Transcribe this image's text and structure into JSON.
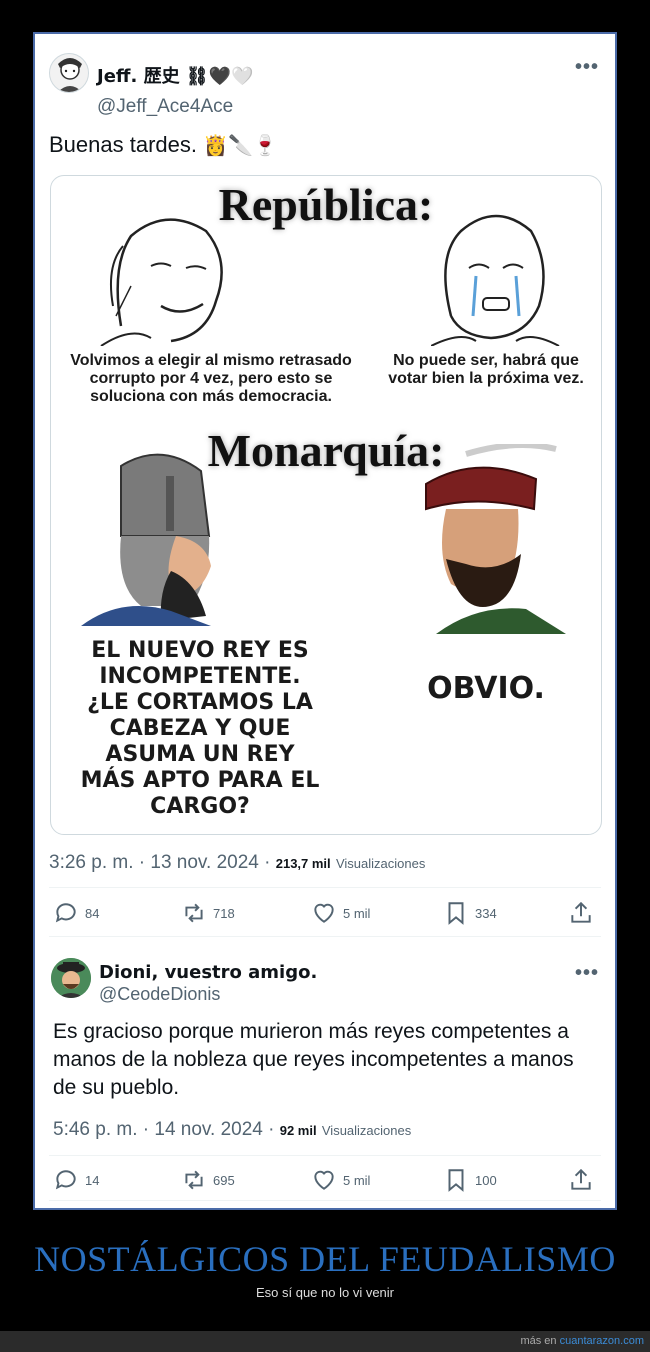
{
  "tweet": {
    "name": "Jeff. 歴史 ⛓🖤🤍",
    "handle": "@Jeff_Ace4Ace",
    "text": "Buenas tardes.",
    "emojis": "👸🔪🍷",
    "time": "3:26 p. m. · 13 nov. 2024 ·",
    "views_count": "213,7 mil",
    "views_label": "Visualizaciones",
    "replies": "84",
    "reposts": "718",
    "likes": "5 mil",
    "bookmarks": "334"
  },
  "meme": {
    "title_top": "República:",
    "caption_left": "Volvimos a elegir al mismo retrasado corrupto por 4 vez, pero esto se soluciona con más democracia.",
    "caption_right": "No puede ser, habrá que votar bien la próxima vez.",
    "title_bottom": "Monarquía:",
    "caption_knight": "EL NUEVO REY ES INCOMPETENTE. ¿LE CORTAMOS LA CABEZA Y QUE ASUMA UN REY MÁS APTO PARA EL CARGO?",
    "caption_noble": "OBVIO."
  },
  "reply": {
    "name": "Dioni, vuestro amigo.",
    "handle": "@CeodeDionis",
    "text": "Es gracioso porque murieron más reyes competentes a manos de la nobleza que reyes incompetentes a manos de su pueblo.",
    "time": "5:46 p. m. · 14 nov. 2024 ·",
    "views_count": "92 mil",
    "views_label": "Visualizaciones",
    "replies": "14",
    "reposts": "695",
    "likes": "5 mil",
    "bookmarks": "100"
  },
  "caption": {
    "title": "NOSTÁLGICOS DEL FEUDALISMO",
    "subtitle": "Eso sí que no lo vi venir"
  },
  "footer": {
    "prefix": "más en",
    "link": "cuantarazon.com"
  },
  "colors": {
    "card_border": "#4b6ba8",
    "caption_title": "#2a6fbf",
    "footer_link": "#3b8bd6"
  }
}
